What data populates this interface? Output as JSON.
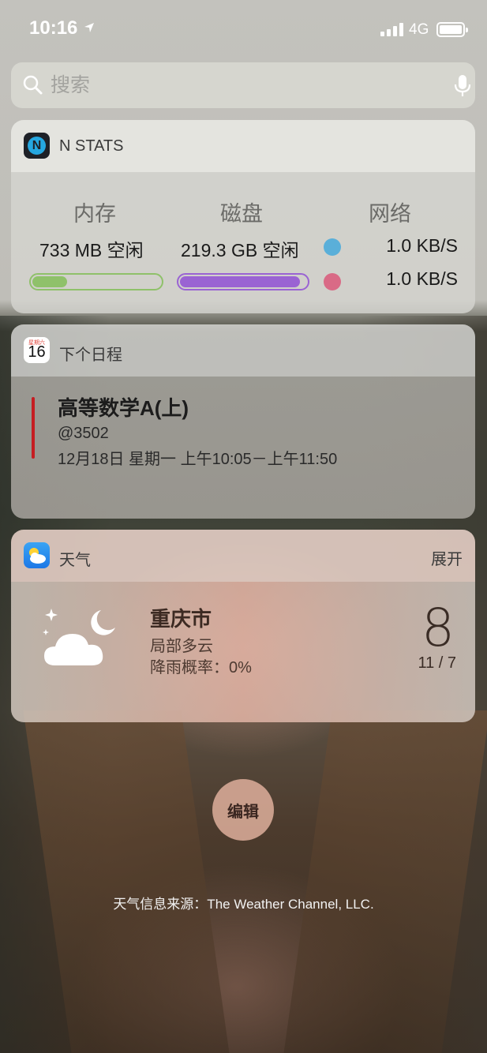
{
  "status_bar": {
    "time": "10:16",
    "network": "4G"
  },
  "search": {
    "placeholder": "搜索"
  },
  "nstats": {
    "title": "N STATS",
    "columns": [
      "内存",
      "磁盘",
      "网络"
    ],
    "memory_free": "733 MB 空闲",
    "disk_free": "219.3 GB 空闲",
    "upload": "1.0 KB/S",
    "download": "1.0 KB/S",
    "memory_usage_fraction": 0.27,
    "disk_usage_fraction": 0.95,
    "colors": {
      "memory": "#8fc16a",
      "disk": "#9a63d3",
      "upload_dot": "#5aafd9",
      "download_dot": "#d96a86"
    }
  },
  "calendar": {
    "title": "下个日程",
    "icon_day": "16",
    "icon_weekday": "星期六",
    "event": {
      "title": "高等数学A(上)",
      "location": "@3502",
      "time": "12月18日 星期一 上午10:05－上午11:50"
    }
  },
  "weather": {
    "title": "天气",
    "action": "展开",
    "city": "重庆市",
    "condition": "局部多云",
    "rain_chance": "降雨概率：0%",
    "temperature": "8",
    "range": "11 / 7"
  },
  "edit_button": "编辑",
  "footer": "天气信息来源：The Weather Channel, LLC."
}
